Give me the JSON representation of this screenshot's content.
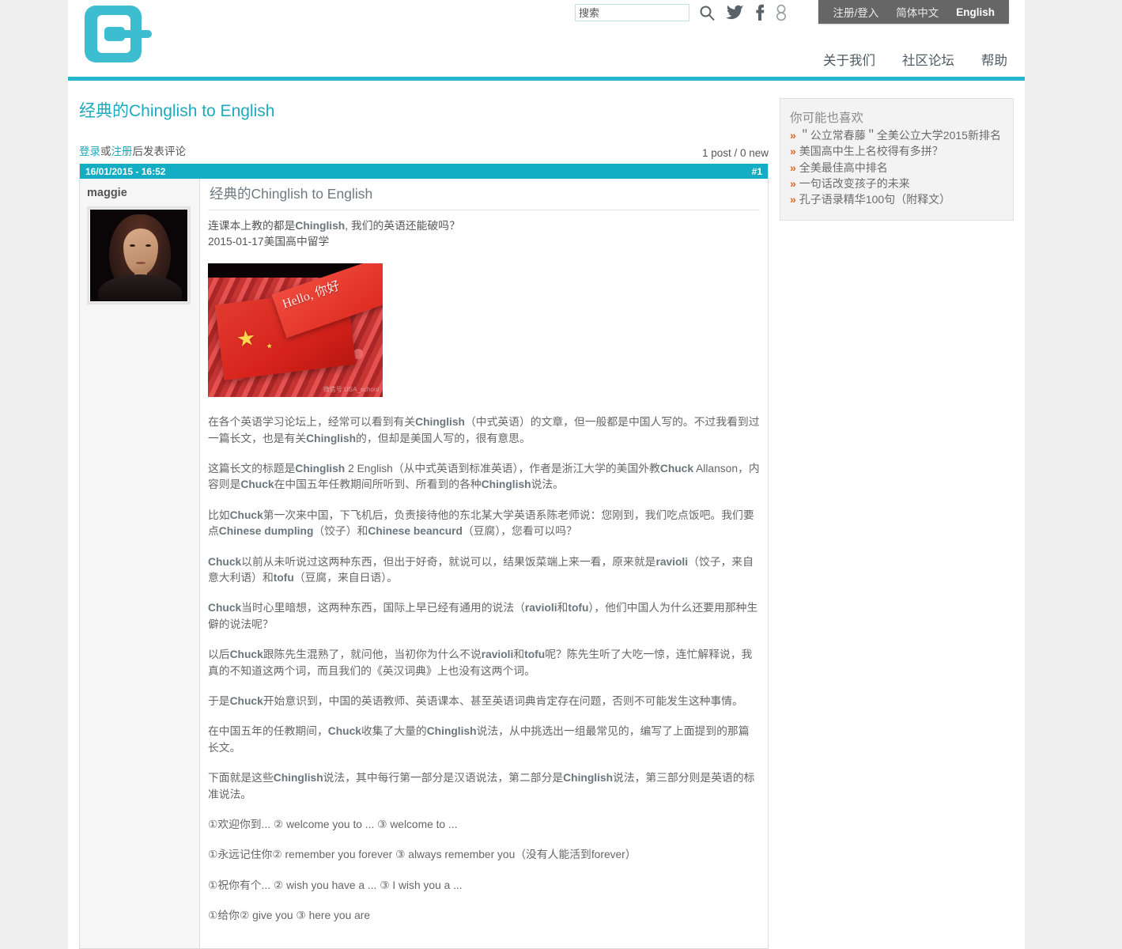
{
  "colors": {
    "brand_teal": "#22b7cd",
    "post_header_teal": "#14adc4",
    "title_teal": "#1fa9bd",
    "util_bar_gray": "#666666",
    "page_bg": "#efefef",
    "sidebar_marker_orange": "#e2622a"
  },
  "header": {
    "logo_icon": "logo-plug-c-icon",
    "search": {
      "placeholder": "搜索",
      "value": "",
      "search_icon": "search-icon"
    },
    "social": [
      {
        "icon": "twitter-icon",
        "name": "twitter"
      },
      {
        "icon": "facebook-icon",
        "name": "facebook"
      },
      {
        "icon": "google-plus-icon",
        "name": "google-plus"
      }
    ],
    "utility": [
      {
        "label": "注册/登入",
        "active": false
      },
      {
        "label": "简体中文",
        "active": false
      },
      {
        "label": "English",
        "active": true
      }
    ],
    "nav": [
      {
        "label": "关于我们"
      },
      {
        "label": "社区论坛"
      },
      {
        "label": "帮助"
      }
    ]
  },
  "main": {
    "page_title_prefix": "经典的",
    "page_title_suffix": "Chinglish to English",
    "comment_prompt": {
      "login": "登录",
      "or": "或",
      "register": "注册",
      "rest": "后发表评论"
    },
    "post_count": "1 post / 0 new",
    "post": {
      "timestamp": "16/01/2015 - 16:52",
      "number": "#1",
      "author": "maggie",
      "avatar_icon": "avatar",
      "title": "经典的Chinglish to English",
      "lede_line1_a": "连课本上教的都是",
      "lede_line1_b": "Chinglish",
      "lede_line1_c": ", 我们的英语还能破吗？",
      "lede_line2": "2015-01-17美国高中留学",
      "figure": {
        "banner_text": "Hello, 你好",
        "watermark": "微信号:USA_school",
        "alt": "红色人群与中国国旗"
      },
      "paragraphs": [
        "在各个英语学习论坛上，经常可以看到有关Chinglish（中式英语）的文章，但一般都是中国人写的。不过我看到过一篇长文，也是有关Chinglish的，但却是美国人写的，很有意思。",
        "这篇长文的标题是Chinglish 2 English（从中式英语到标准英语），作者是浙江大学的美国外教Chuck Allanson，内容则是Chuck在中国五年任教期间所听到、所看到的各种Chinglish说法。",
        "比如Chuck第一次来中国，下飞机后，负责接待他的东北某大学英语系陈老师说：您刚到，我们吃点饭吧。我们要点Chinese dumpling（饺子）和Chinese beancurd（豆腐），您看可以吗？",
        "Chuck以前从未听说过这两种东西，但出于好奇，就说可以，结果饭菜端上来一看，原来就是ravioli（饺子，来自意大利语）和tofu（豆腐，来自日语）。",
        "Chuck当时心里暗想，这两种东西，国际上早已经有通用的说法（ravioli和tofu），他们中国人为什么还要用那种生僻的说法呢？",
        "以后Chuck跟陈先生混熟了，就问他，当初你为什么不说ravioli和tofu呢？陈先生听了大吃一惊，连忙解释说，我真的不知道这两个词，而且我们的《英汉词典》上也没有这两个词。",
        "于是Chuck开始意识到，中国的英语教师、英语课本、甚至英语词典肯定存在问题，否则不可能发生这种事情。",
        "在中国五年的任教期间，Chuck收集了大量的Chinglish说法，从中挑选出一组最常见的，编写了上面提到的那篇长文。",
        "下面就是这些Chinglish说法，其中每行第一部分是汉语说法，第二部分是Chinglish说法，第三部分则是英语的标准说法。",
        "①欢迎你到... ② welcome you to ... ③ welcome to ...",
        "①永远记住你② remember you forever ③ always remember you（没有人能活到forever）",
        "①祝你有个... ② wish you have a ... ③ I wish you a ...",
        "①给你② give you ③ here you are"
      ]
    }
  },
  "sidebar": {
    "title": "你可能也喜欢",
    "marker": "»",
    "items": [
      {
        "label": "＂公立常春藤＂全美公立大学2015新排名"
      },
      {
        "label": "美国高中生上名校得有多拼？"
      },
      {
        "label": "全美最佳高中排名"
      },
      {
        "label": "一句话改变孩子的未来"
      },
      {
        "label": "孔子语录精华100句（附释文）"
      }
    ]
  }
}
